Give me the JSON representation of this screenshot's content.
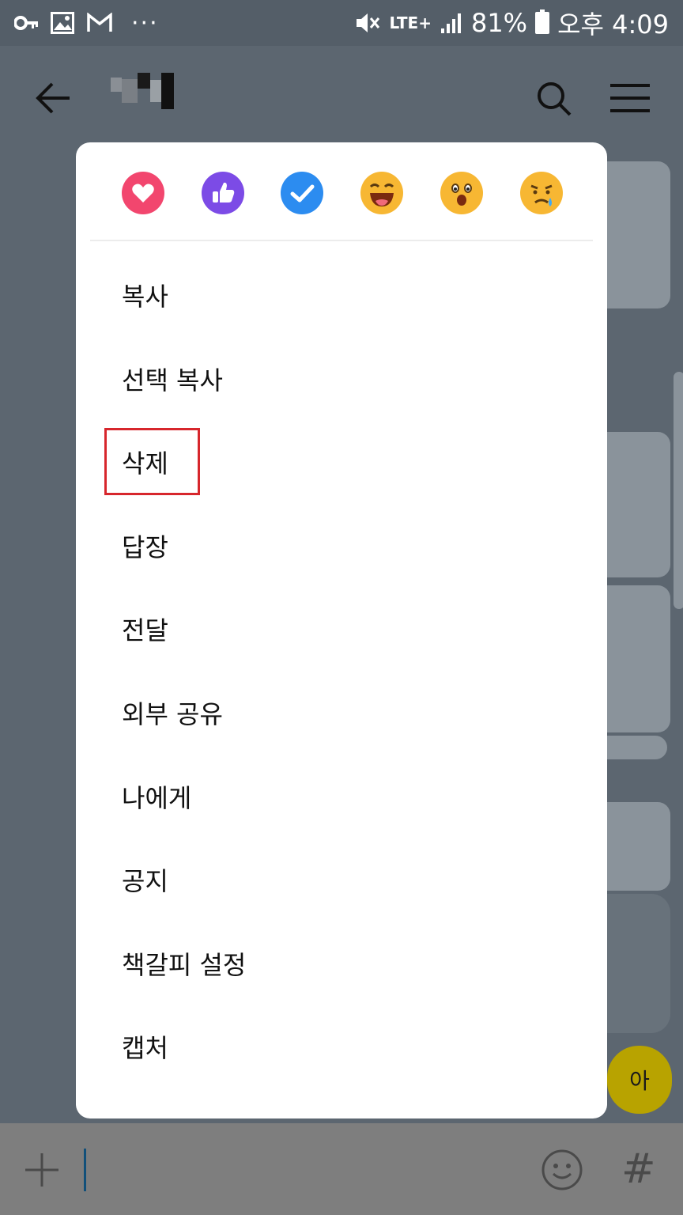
{
  "status_bar": {
    "battery": "81%",
    "time": "오후 4:09",
    "network": "LTE+",
    "dots": "···"
  },
  "header": {
    "back_icon": "arrow-left-icon",
    "search_icon": "search-icon",
    "menu_icon": "hamburger-menu-icon"
  },
  "reactions": [
    {
      "name": "heart",
      "color": "#f2466e"
    },
    {
      "name": "thumbs-up",
      "color": "#7c4be6"
    },
    {
      "name": "check",
      "color": "#2c8cf0"
    },
    {
      "name": "laughing",
      "color": "#f7b733"
    },
    {
      "name": "surprised",
      "color": "#f7b733"
    },
    {
      "name": "sad",
      "color": "#f7b733"
    }
  ],
  "menu": {
    "items": [
      {
        "label": "복사"
      },
      {
        "label": "선택 복사"
      },
      {
        "label": "삭제"
      },
      {
        "label": "답장"
      },
      {
        "label": "전달"
      },
      {
        "label": "외부 공유"
      },
      {
        "label": "나에게"
      },
      {
        "label": "공지"
      },
      {
        "label": "책갈피 설정"
      },
      {
        "label": "캡처"
      }
    ],
    "highlighted": "삭제",
    "highlight_color": "#d7262c"
  },
  "background": {
    "yellow_bubble_text": "아"
  },
  "input_bar": {
    "plus_icon": "plus-icon",
    "emoji_icon": "smiley-icon",
    "hash_label": "#"
  }
}
